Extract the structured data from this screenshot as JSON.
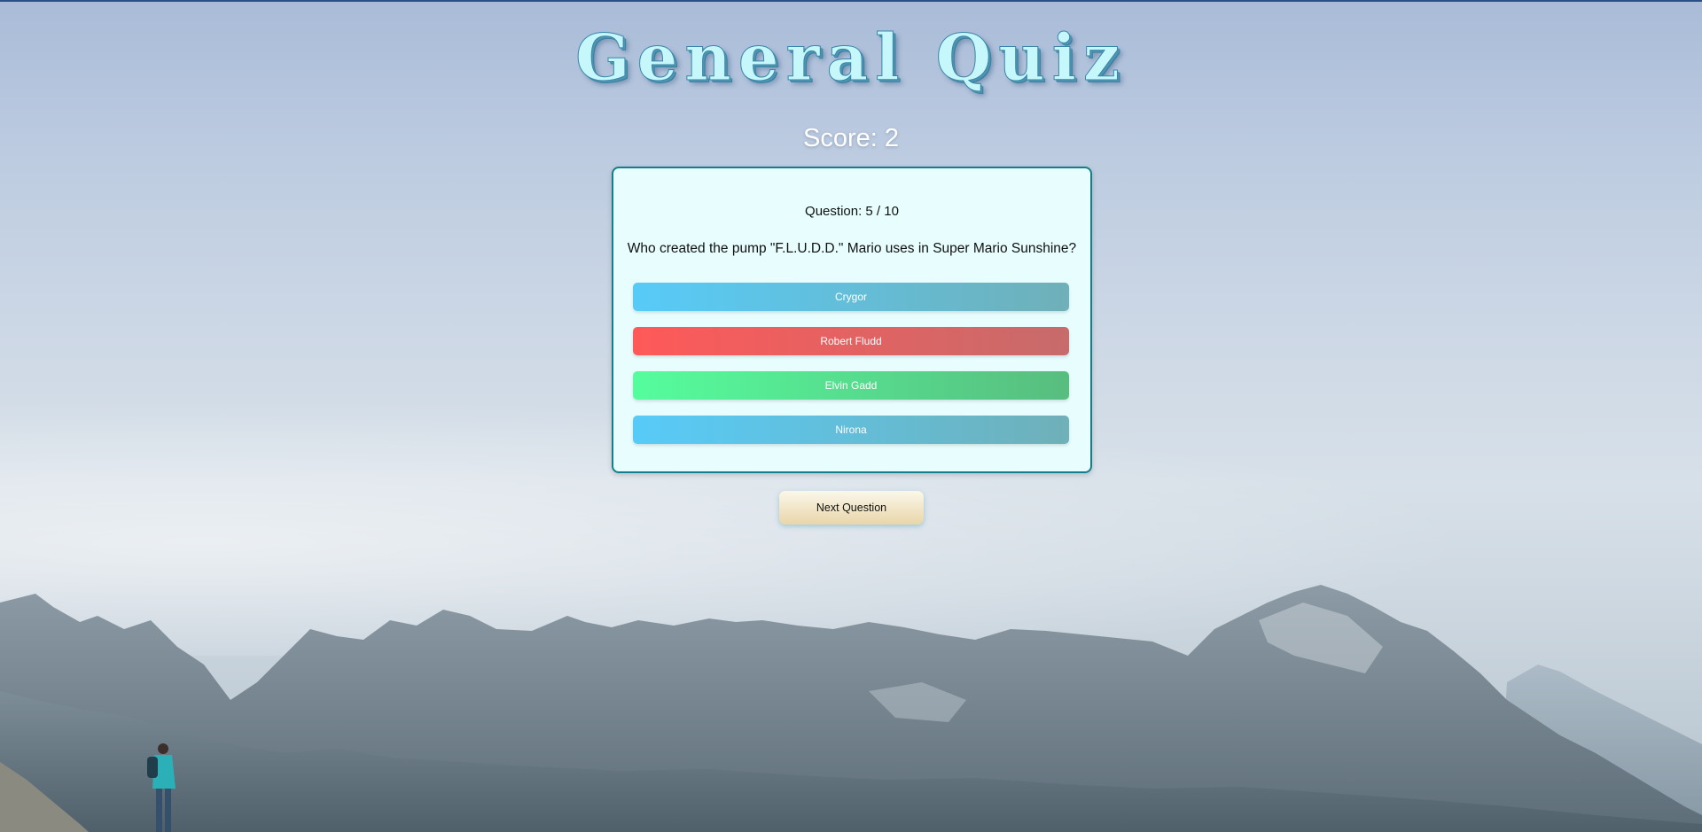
{
  "app": {
    "title": "General Quiz",
    "score_text": "Score: 2"
  },
  "question": {
    "counter": "Question: 5 / 10",
    "text": "Who created the pump \"F.L.U.D.D.\" Mario uses in Super Mario Sunshine?"
  },
  "answers": [
    {
      "label": "Crygor",
      "state": "neutral"
    },
    {
      "label": "Robert Fludd",
      "state": "wrong"
    },
    {
      "label": "Elvin Gadd",
      "state": "correct"
    },
    {
      "label": "Nirona",
      "state": "neutral"
    }
  ],
  "controls": {
    "next_label": "Next Question"
  },
  "colors": {
    "card_background": "#e7fdfe",
    "card_border": "#147f8c",
    "neutral_answer": "#57cbf8",
    "wrong_answer": "#ff5959",
    "correct_answer": "#55fd9d",
    "title_fill": "#c6f8fb"
  },
  "background": {
    "scene": "mountain-landscape-with-hiker"
  }
}
